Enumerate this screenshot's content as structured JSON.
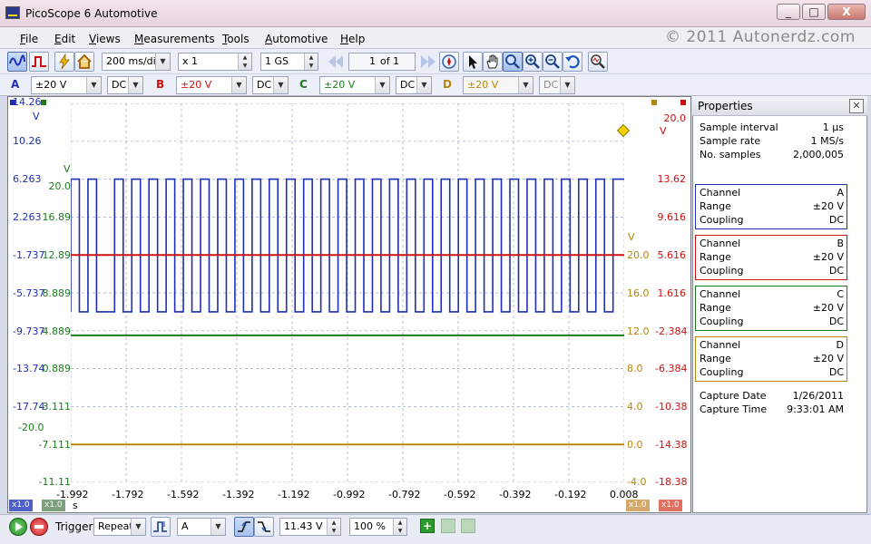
{
  "window": {
    "title": "PicoScope 6 Automotive",
    "minimize": "_",
    "maximize": "□",
    "close": "X"
  },
  "menu": {
    "items": [
      "File",
      "Edit",
      "Views",
      "Measurements",
      "Tools",
      "Automotive",
      "Help"
    ],
    "copyright": "© 2011  Autonerdz.com"
  },
  "toolbar": {
    "timebase": "200 ms/div",
    "zoom": "x 1",
    "samples": "1 GS",
    "buffer_page": "1",
    "buffer_of": "of 1"
  },
  "channels": [
    {
      "label": "A",
      "range": "±20 V",
      "coupling": "DC",
      "color": "#1e2fb4"
    },
    {
      "label": "B",
      "range": "±20 V",
      "coupling": "DC",
      "color": "#cc1111"
    },
    {
      "label": "C",
      "range": "±20 V",
      "coupling": "DC",
      "color": "#1d7a1d"
    },
    {
      "label": "D",
      "range": "±20 V",
      "coupling": "DC",
      "color": "#b8860b"
    }
  ],
  "axes": {
    "a_ticks": [
      "14.26",
      "10.26",
      "6.263",
      "2.263",
      "-1.737",
      "-5.737",
      "-9.737",
      "-13.74",
      "-17.74"
    ],
    "a_unit": "V",
    "c_ticks": [
      "20.0",
      "16.89",
      "12.89",
      "8.889",
      "4.889",
      "0.889",
      "-3.111",
      "-7.111",
      "-11.11"
    ],
    "c_unit": "V",
    "c_extra": "-20.0",
    "d_ticks": [
      "20.0",
      "16.0",
      "12.0",
      "8.0",
      "4.0",
      "0.0",
      "-4.0"
    ],
    "d_unit": "V",
    "b_ticks": [
      "20.0",
      "13.62",
      "9.616",
      "5.616",
      "1.616",
      "-2.384",
      "-6.384",
      "-10.38",
      "-14.38",
      "-18.38"
    ],
    "b_unit": "V",
    "x_ticks": [
      "-1.992",
      "-1.792",
      "-1.592",
      "-1.392",
      "-1.192",
      "-0.992",
      "-0.792",
      "-0.592",
      "-0.392",
      "-0.192",
      "0.008"
    ],
    "x_unit": "s",
    "scale_a": "x1.0",
    "scale_c": "x1.0",
    "scale_d": "x1.0",
    "scale_b": "x1.0"
  },
  "chart_data": {
    "type": "line",
    "x_range": [
      -1.992,
      0.008
    ],
    "xlabel": "s",
    "series": [
      {
        "name": "A",
        "color": "#1e2fb4",
        "kind": "square-wave",
        "high_v": 14.26,
        "low_v": 0.26,
        "duty": 0.5,
        "cycles": 31,
        "gap_after_cycle": 2,
        "ylim": [
          -17.74,
          22.26
        ]
      },
      {
        "name": "B",
        "color": "#cc1111",
        "kind": "flat",
        "value_v": 1.616,
        "ylim": [
          -22.38,
          17.62
        ]
      },
      {
        "name": "C",
        "color": "#1d7a1d",
        "kind": "flat",
        "value_v": 0.4,
        "ylim": [
          -15.11,
          24.89
        ]
      },
      {
        "name": "D",
        "color": "#b8860b",
        "kind": "flat",
        "value_v": 0.0,
        "ylim": [
          -4.0,
          36.0
        ]
      }
    ]
  },
  "properties": {
    "title": "Properties",
    "close": "✕",
    "summary": [
      {
        "label": "Sample interval",
        "value": "1 µs"
      },
      {
        "label": "Sample rate",
        "value": "1 MS/s"
      },
      {
        "label": "No. samples",
        "value": "2,000,005"
      }
    ],
    "channels": [
      {
        "channel_label": "Channel",
        "channel": "A",
        "range_label": "Range",
        "range": "±20 V",
        "coupling_label": "Coupling",
        "coupling": "DC",
        "color": "#1e2fb4"
      },
      {
        "channel_label": "Channel",
        "channel": "B",
        "range_label": "Range",
        "range": "±20 V",
        "coupling_label": "Coupling",
        "coupling": "DC",
        "color": "#cc1111"
      },
      {
        "channel_label": "Channel",
        "channel": "C",
        "range_label": "Range",
        "range": "±20 V",
        "coupling_label": "Coupling",
        "coupling": "DC",
        "color": "#1d7a1d"
      },
      {
        "channel_label": "Channel",
        "channel": "D",
        "range_label": "Range",
        "range": "±20 V",
        "coupling_label": "Coupling",
        "coupling": "DC",
        "color": "#b8860b"
      }
    ],
    "capture": [
      {
        "label": "Capture Date",
        "value": "1/26/2011"
      },
      {
        "label": "Capture Time",
        "value": "9:33:01 AM"
      }
    ]
  },
  "statusbar": {
    "trigger_label": "Trigger",
    "trigger_mode": "Repeat",
    "trigger_source": "A",
    "trigger_level": "11.43 V",
    "pre_trigger": "100 %"
  }
}
